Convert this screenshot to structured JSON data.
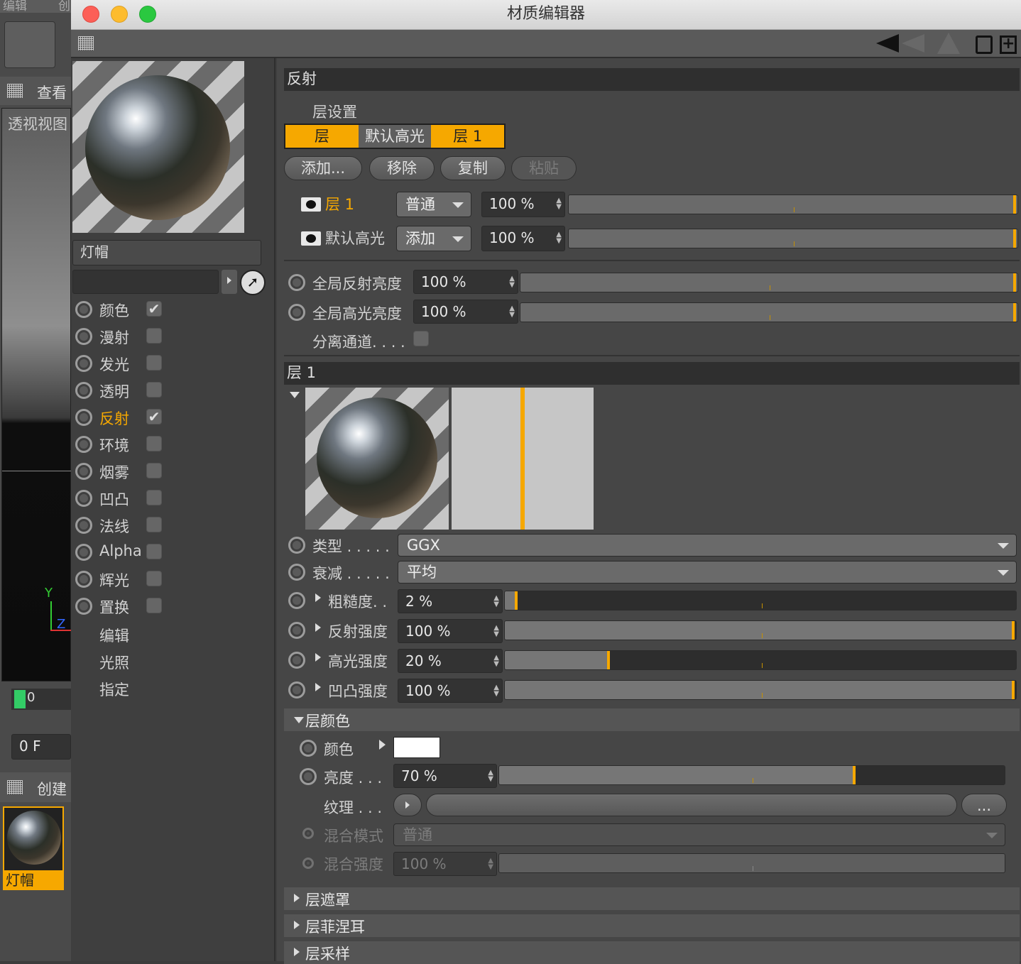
{
  "bg_app": {
    "menu": [
      "编辑",
      "创"
    ],
    "view_label": "查看",
    "viewport_label": "透视视图",
    "timeline_value": "0",
    "frame_value": "0 F",
    "create_label": "创建",
    "material_name": "灯帽",
    "axis_y": "Y",
    "axis_z": "Z"
  },
  "window": {
    "title": "材质编辑器"
  },
  "left": {
    "material_name": "灯帽",
    "channels": [
      {
        "label": "颜色",
        "checked": true,
        "active": false
      },
      {
        "label": "漫射",
        "checked": false,
        "active": false
      },
      {
        "label": "发光",
        "checked": false,
        "active": false
      },
      {
        "label": "透明",
        "checked": false,
        "active": false
      },
      {
        "label": "反射",
        "checked": true,
        "active": true
      },
      {
        "label": "环境",
        "checked": false,
        "active": false
      },
      {
        "label": "烟雾",
        "checked": false,
        "active": false
      },
      {
        "label": "凹凸",
        "checked": false,
        "active": false
      },
      {
        "label": "法线",
        "checked": false,
        "active": false
      },
      {
        "label": "Alpha",
        "checked": false,
        "active": false
      },
      {
        "label": "辉光",
        "checked": false,
        "active": false
      },
      {
        "label": "置换",
        "checked": false,
        "active": false
      }
    ],
    "extra": [
      "编辑",
      "光照",
      "指定"
    ]
  },
  "reflect": {
    "section_title": "反射",
    "layer_settings": "层设置",
    "tabs": [
      "层",
      "默认高光",
      "层 1"
    ],
    "buttons": [
      "添加...",
      "移除",
      "复制",
      "粘贴"
    ],
    "layers": [
      {
        "name": "层 1",
        "mode": "普通",
        "value": "100 %",
        "level": 1.0
      },
      {
        "name": "默认高光",
        "mode": "添加",
        "value": "100 %",
        "level": 1.0
      }
    ],
    "global_reflect_label": "全局反射亮度",
    "global_reflect_value": "100 %",
    "global_reflect_level": 1.0,
    "global_spec_label": "全局高光亮度",
    "global_spec_value": "100 %",
    "global_spec_level": 1.0,
    "separate_label": "分离通道. . . ."
  },
  "layer1": {
    "title": "层 1",
    "type_label": "类型 . . . . .",
    "type_value": "GGX",
    "atten_label": "衰减 . . . . .",
    "atten_value": "平均",
    "params": [
      {
        "label": "粗糙度. .",
        "value": "2 %",
        "level": 0.02
      },
      {
        "label": "反射强度",
        "value": "100 %",
        "level": 1.0
      },
      {
        "label": "高光强度",
        "value": "20 %",
        "level": 0.2
      },
      {
        "label": "凹凸强度",
        "value": "100 %",
        "level": 1.0
      }
    ],
    "color_section": "层颜色",
    "color_label": "颜色",
    "color_swatch": "#ffffff",
    "brightness_label": "亮度 . . .",
    "brightness_value": "70 %",
    "brightness_level": 0.7,
    "texture_label": "纹理 . . .",
    "texture_more": "...",
    "blend_mode_label": "混合模式",
    "blend_mode_value": "普通",
    "blend_strength_label": "混合强度",
    "blend_strength_value": "100 %",
    "collapsed": [
      "层遮罩",
      "层菲涅耳",
      "层采样"
    ]
  },
  "accent": "#f6a800"
}
